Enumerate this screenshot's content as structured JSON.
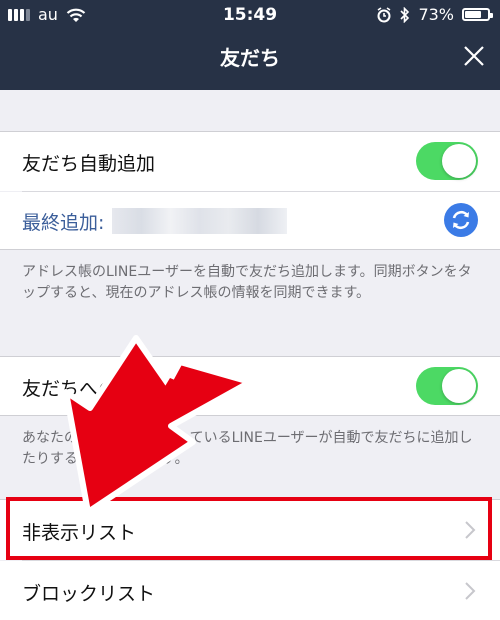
{
  "status_bar": {
    "carrier": "au",
    "time": "15:49",
    "battery_percent_text": "73%",
    "battery_level": 0.73
  },
  "header": {
    "title": "友だち"
  },
  "settings": {
    "auto_add": {
      "label": "友だち自動追加",
      "enabled": true,
      "last_added_label": "最終追加:"
    },
    "auto_add_note": "アドレス帳のLINEユーザーを自動で友だち追加します。同期ボタンをタップすると、現在のアドレス帳の情報を同期できます。",
    "allow_add": {
      "label": "友だちへの追加を許可",
      "enabled": true
    },
    "allow_add_note": "あなたの電話番号を保有しているLINEユーザーが自動で友だちに追加したりすることができます。",
    "hidden_list_label": "非表示リスト",
    "blocked_list_label": "ブロックリスト"
  },
  "icons": {
    "close": "close-icon",
    "sync": "sync-icon",
    "chevron": "chevron-right-icon",
    "annotation_arrow": "red-arrow-icon"
  },
  "colors": {
    "header_bg": "#273246",
    "toggle_on": "#4cd964",
    "sync_blue": "#3b7be6",
    "link_blue": "#3b5e9a",
    "highlight_red": "#e60012"
  }
}
